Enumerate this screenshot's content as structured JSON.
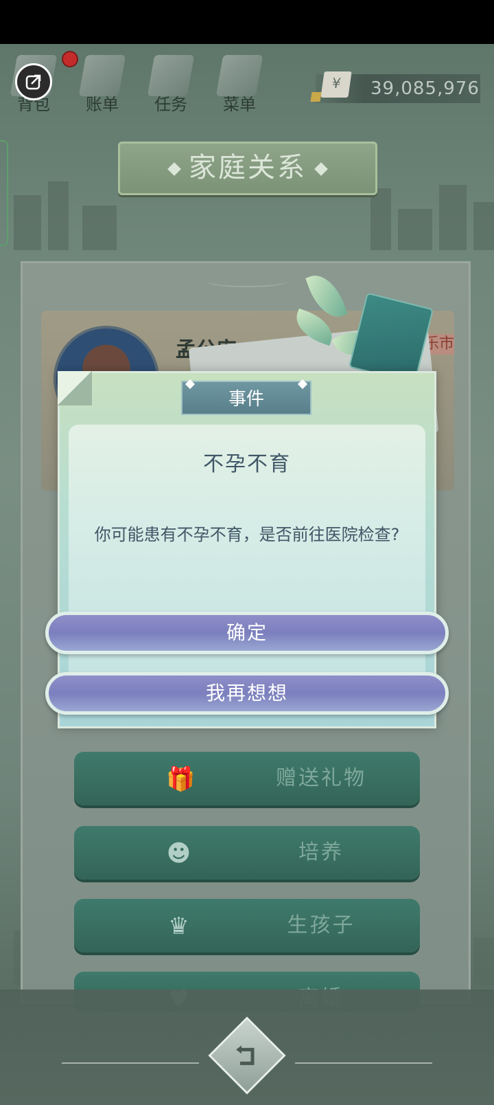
{
  "top_nav": {
    "items": [
      {
        "label": "背包",
        "icon": "backpack-icon"
      },
      {
        "label": "账单",
        "icon": "bill-icon"
      },
      {
        "label": "任务",
        "icon": "task-icon"
      },
      {
        "label": "菜单",
        "icon": "menu-icon"
      }
    ],
    "money": "39,085,976",
    "currency_symbol": "¥"
  },
  "page_title": "家庭关系",
  "profile": {
    "name": "孟公安",
    "tag": "乐市"
  },
  "dialog": {
    "header": "事件",
    "title": "不孕不育",
    "message": "你可能患有不孕不育，是否前往医院检查?",
    "confirm_label": "确定",
    "reconsider_label": "我再想想"
  },
  "actions": [
    {
      "label": "赠送礼物",
      "icon": "gift-icon"
    },
    {
      "label": "培养",
      "icon": "reading-person-icon"
    },
    {
      "label": "生孩子",
      "icon": "angel-icon"
    },
    {
      "label": "离婚",
      "icon": "broken-heart-icon"
    }
  ],
  "colors": {
    "accent_green": "#3f7a6c",
    "dialog_button": "#7b7fbd",
    "notification": "#c42c2c"
  }
}
